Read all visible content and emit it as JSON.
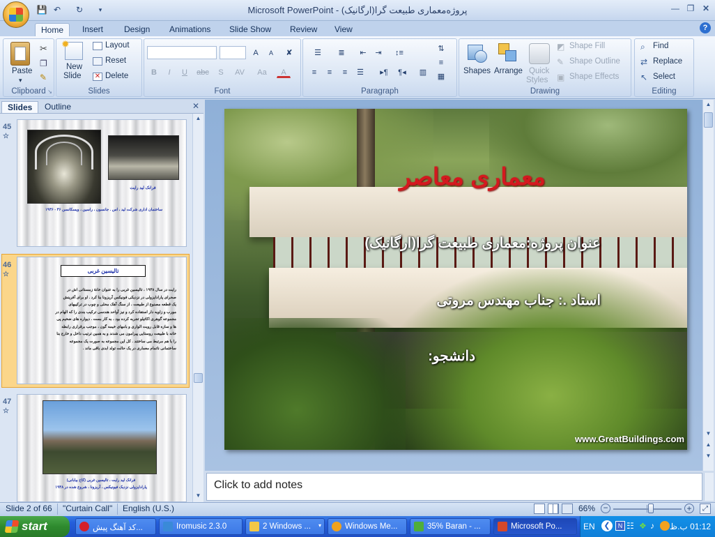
{
  "window": {
    "title": "Microsoft PowerPoint - (ارگانیک)پروژه‌معماری طبیعت گرا",
    "controls": [
      "minimize",
      "restore",
      "close"
    ]
  },
  "ribbon": {
    "tabs": [
      "Home",
      "Insert",
      "Design",
      "Animations",
      "Slide Show",
      "Review",
      "View"
    ],
    "active_tab": "Home",
    "clipboard": {
      "paste": "Paste",
      "label": "Clipboard"
    },
    "slides": {
      "new_slide_line1": "New",
      "new_slide_line2": "Slide",
      "layout": "Layout",
      "reset": "Reset",
      "delete": "Delete",
      "label": "Slides"
    },
    "font": {
      "label": "Font",
      "bold": "B",
      "italic": "I",
      "underline": "U",
      "strike": "abc",
      "shadow": "S",
      "spacing": "AV",
      "case": "Aa",
      "color": "A",
      "grow": "A",
      "shrink": "A"
    },
    "paragraph": {
      "label": "Paragraph"
    },
    "drawing": {
      "shapes": "Shapes",
      "arrange": "Arrange",
      "quick_styles_1": "Quick",
      "quick_styles_2": "Styles",
      "shape_fill": "Shape Fill",
      "shape_outline": "Shape Outline",
      "shape_effects": "Shape Effects",
      "label": "Drawing"
    },
    "editing": {
      "find": "Find",
      "replace": "Replace",
      "select": "Select",
      "label": "Editing"
    }
  },
  "panel": {
    "tabs": [
      "Slides",
      "Outline"
    ],
    "active_tab": "Slides",
    "thumbnails": [
      {
        "number": "45",
        "caption1": "فرانک لید رایت",
        "caption2": "ساختمان اداری شرکت لید ، اس . جانسون ، راسین ، ویسکانسن ۳۶ - ۱۹۳۶"
      },
      {
        "number": "46",
        "heading": "تالیسین غربی",
        "selected": true,
        "body": [
          "رایت در سال ۱۹۳۸ ، تالیسین غربی را به عنوان خانهٔ زمستانی اش در",
          "صحرای پارادایزولی در نزدیکی فونیکس آریزونا بنا کرد . او برای آفرینش",
          "یک قطعه مصنوع از طبیعت ، از سنگ آهک محلی و چوب در ترکیبهای",
          "مورب و زاویه دار استفاده کرد و نیز آواحد هندسی ترکیب بندی را که الهام در",
          "مجموعه گوهری اکاتیلو تجربه کرده بود ، به کار بست . دیواره های ضخیم پی",
          "ها و سازه قابل رویت الواری و بامهای خیمه گون ، موجب برقراری رابطه",
          "خانه با طبیعت روستایی پیرامون می شدند و به همین ترتیب داخل و خارج بنا",
          "را با هم مرتبط می ساختند . کل این مجموعه به صورت یک مجموعه",
          "ساختمانی ناتمام معماری در یک حالت تولد ابدی باقی ماند ."
        ]
      },
      {
        "number": "47",
        "caption1": "فرانک لید رایت ، تالیسین غربی (کاخ بیابانی)",
        "caption2": "پارادایزولی نزدیک فیونیکس ، آریزونا ، شروع شده در ۱۹۳۸"
      }
    ]
  },
  "slide": {
    "title": "معماری معاصر",
    "project": "عنوان پروژه:معماری طبیعت گرا(ارگانیک)",
    "professor": "استاد .: جناب مهندس مروتی",
    "student": "دانشجو:",
    "watermark": "www.GreatBuildings.com"
  },
  "notes": {
    "placeholder": "Click to add notes"
  },
  "status": {
    "slide_info": "Slide 2 of 66",
    "theme": "\"Curtain Call\"",
    "language": "English (U.S.)",
    "zoom": "66%",
    "zoom_fraction": 0.55
  },
  "taskbar": {
    "start": "start",
    "tasks": [
      {
        "label": "کد آهنگ پیش...",
        "color": "#d4202a"
      },
      {
        "label": "Iromusic 2.3.0",
        "color": "#3a8ad8"
      },
      {
        "label": "2 Windows ...",
        "color": "#f3c846"
      },
      {
        "label": "Windows Me...",
        "color": "#f1a21e"
      },
      {
        "label": "35% Baran - ...",
        "color": "#4fae3a"
      },
      {
        "label": "Microsoft Po...",
        "color": "#d4482a",
        "active": true
      }
    ],
    "tray": {
      "language": "EN",
      "clock": "01:12 ب.ظ"
    }
  },
  "colors": {
    "slide_title": "#d4191f",
    "ribbon_text": "#15315a",
    "selection": "#fbd68a"
  }
}
